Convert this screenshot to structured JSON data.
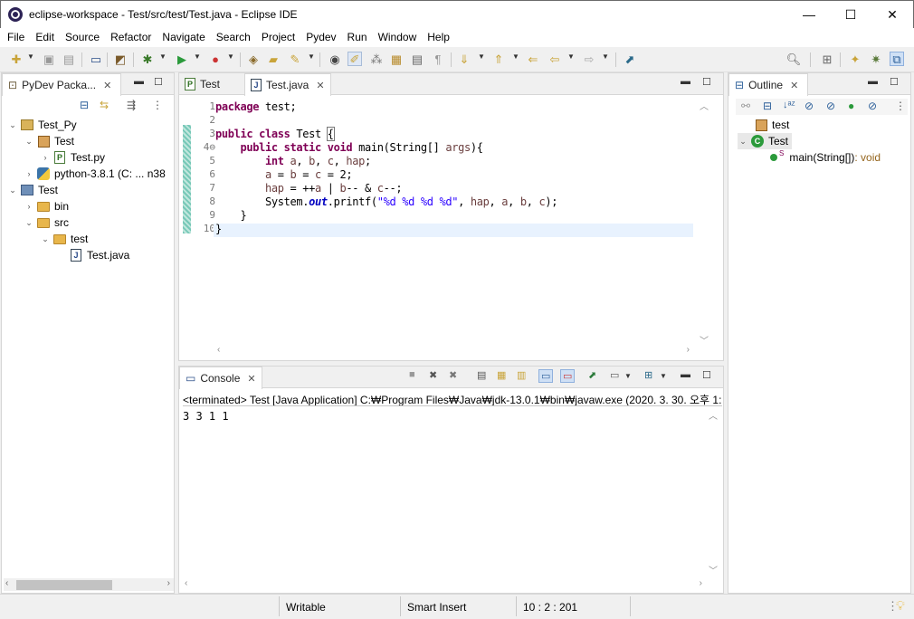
{
  "window": {
    "title": "eclipse-workspace - Test/src/test/Test.java - Eclipse IDE",
    "minimize": "—",
    "maximize": "☐",
    "close": "✕"
  },
  "menu": [
    "File",
    "Edit",
    "Source",
    "Refactor",
    "Navigate",
    "Search",
    "Project",
    "Pydev",
    "Run",
    "Window",
    "Help"
  ],
  "toolbar_icons": [
    "new-icon",
    "save-icon",
    "save-all-icon",
    "terminal-icon",
    "open-perspective-icon",
    "debug-icon",
    "run-icon",
    "run-external-icon",
    "open-type-icon",
    "open-folder-icon",
    "pencil-icon",
    "annotation-icon",
    "highlight-icon",
    "mark-occurrences-icon",
    "toggle-block-icon",
    "paragraph-icon",
    "next-annotation-icon",
    "prev-annotation-icon",
    "back-icon",
    "forward-icon",
    "pin-icon",
    "search-icon",
    "perspective-icon",
    "java-perspective-icon",
    "debug-perspective-icon",
    "pydev-perspective-icon"
  ],
  "package_explorer": {
    "tab_label": "PyDev Packa...",
    "tree": [
      {
        "label": "Test_Py",
        "icon": "pydev-project-icon",
        "expanded": true
      },
      {
        "label": "Test",
        "icon": "package-icon",
        "expanded": true
      },
      {
        "label": "Test.py",
        "icon": "python-file-icon"
      },
      {
        "label": "python-3.8.1  (C: ... n38",
        "icon": "python-interpreter-icon"
      },
      {
        "label": "Test",
        "icon": "java-project-icon",
        "expanded": true
      },
      {
        "label": "bin",
        "icon": "folder-icon"
      },
      {
        "label": "src",
        "icon": "folder-icon",
        "expanded": true
      },
      {
        "label": "test",
        "icon": "folder-icon",
        "expanded": true
      },
      {
        "label": "Test.java",
        "icon": "java-file-icon"
      }
    ]
  },
  "editor": {
    "tabs": [
      {
        "label": "Test",
        "icon": "python-file-icon",
        "active": false
      },
      {
        "label": "Test.java",
        "icon": "java-file-icon",
        "active": true
      }
    ],
    "line_numbers": [
      "1",
      "2",
      "3",
      "4⊖",
      "5",
      "6",
      "7",
      "8",
      "9",
      "10"
    ],
    "lines": [
      {
        "parts": [
          [
            "kw",
            "package"
          ],
          [
            "p",
            " test;"
          ]
        ]
      },
      {
        "parts": []
      },
      {
        "parts": [
          [
            "kw",
            "public"
          ],
          [
            "p",
            " "
          ],
          [
            "kw",
            "class"
          ],
          [
            "p",
            " Test "
          ],
          [
            "p",
            "{"
          ]
        ]
      },
      {
        "parts": [
          [
            "p",
            "    "
          ],
          [
            "kw",
            "public"
          ],
          [
            "p",
            " "
          ],
          [
            "kw",
            "static"
          ],
          [
            "p",
            " "
          ],
          [
            "kw",
            "void"
          ],
          [
            "p",
            " main(String[] "
          ],
          [
            "var",
            "args"
          ],
          [
            "p",
            "){"
          ]
        ]
      },
      {
        "parts": [
          [
            "p",
            "        "
          ],
          [
            "kw",
            "int"
          ],
          [
            "p",
            " "
          ],
          [
            "var",
            "a"
          ],
          [
            "p",
            ", "
          ],
          [
            "var",
            "b"
          ],
          [
            "p",
            ", "
          ],
          [
            "var",
            "c"
          ],
          [
            "p",
            ", "
          ],
          [
            "var",
            "hap"
          ],
          [
            "p",
            ";"
          ]
        ]
      },
      {
        "parts": [
          [
            "p",
            "        "
          ],
          [
            "var",
            "a"
          ],
          [
            "p",
            " = "
          ],
          [
            "var",
            "b"
          ],
          [
            "p",
            " = "
          ],
          [
            "var",
            "c"
          ],
          [
            "p",
            " = 2;"
          ]
        ]
      },
      {
        "parts": [
          [
            "p",
            "        "
          ],
          [
            "var",
            "hap"
          ],
          [
            "p",
            " = ++"
          ],
          [
            "var",
            "a"
          ],
          [
            "p",
            " | "
          ],
          [
            "var",
            "b"
          ],
          [
            "p",
            "-- & "
          ],
          [
            "var",
            "c"
          ],
          [
            "p",
            "--;"
          ]
        ]
      },
      {
        "parts": [
          [
            "p",
            "        System."
          ],
          [
            "fld",
            "out"
          ],
          [
            "p",
            ".printf("
          ],
          [
            "str",
            "\"%d %d %d %d\""
          ],
          [
            "p",
            ", "
          ],
          [
            "var",
            "hap"
          ],
          [
            "p",
            ", "
          ],
          [
            "var",
            "a"
          ],
          [
            "p",
            ", "
          ],
          [
            "var",
            "b"
          ],
          [
            "p",
            ", "
          ],
          [
            "var",
            "c"
          ],
          [
            "p",
            ");"
          ]
        ]
      },
      {
        "parts": [
          [
            "p",
            "    }"
          ]
        ]
      },
      {
        "parts": [
          [
            "p",
            "}"
          ]
        ]
      }
    ]
  },
  "console": {
    "tab_label": "Console",
    "header": "<terminated> Test [Java Application] C:₩Program Files₩Java₩jdk-13.0.1₩bin₩javaw.exe  (2020. 3. 30. 오후 1:",
    "output": "3 3 1 1"
  },
  "outline": {
    "tab_label": "Outline",
    "items": [
      {
        "label": "test",
        "icon": "package-decl-icon"
      },
      {
        "label": "Test",
        "icon": "class-icon"
      },
      {
        "label": "main(String[])",
        "type_suffix": " : void",
        "icon": "public-method-icon",
        "static_marker": "S"
      }
    ]
  },
  "statusbar": {
    "writable": "Writable",
    "insert_mode": "Smart Insert",
    "position": "10 : 2 : 201"
  }
}
